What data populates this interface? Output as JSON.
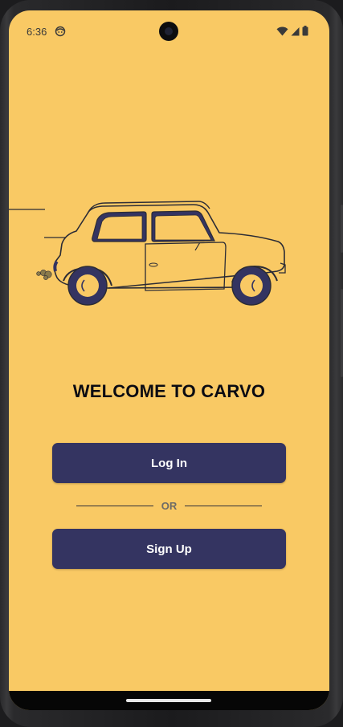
{
  "status_bar": {
    "time": "6:36"
  },
  "welcome": {
    "title": "WELCOME TO CARVO"
  },
  "actions": {
    "login_label": "Log In",
    "divider_label": "OR",
    "signup_label": "Sign Up"
  },
  "icons": {
    "status_app": "face-icon",
    "wifi": "wifi-icon",
    "signal": "cell-signal-icon",
    "battery": "battery-icon",
    "illustration": "car-illustration"
  },
  "colors": {
    "background": "#f9c964",
    "button": "#343461",
    "button_text": "#ffffff",
    "title": "#0b0b12",
    "car_accent": "#343461"
  }
}
